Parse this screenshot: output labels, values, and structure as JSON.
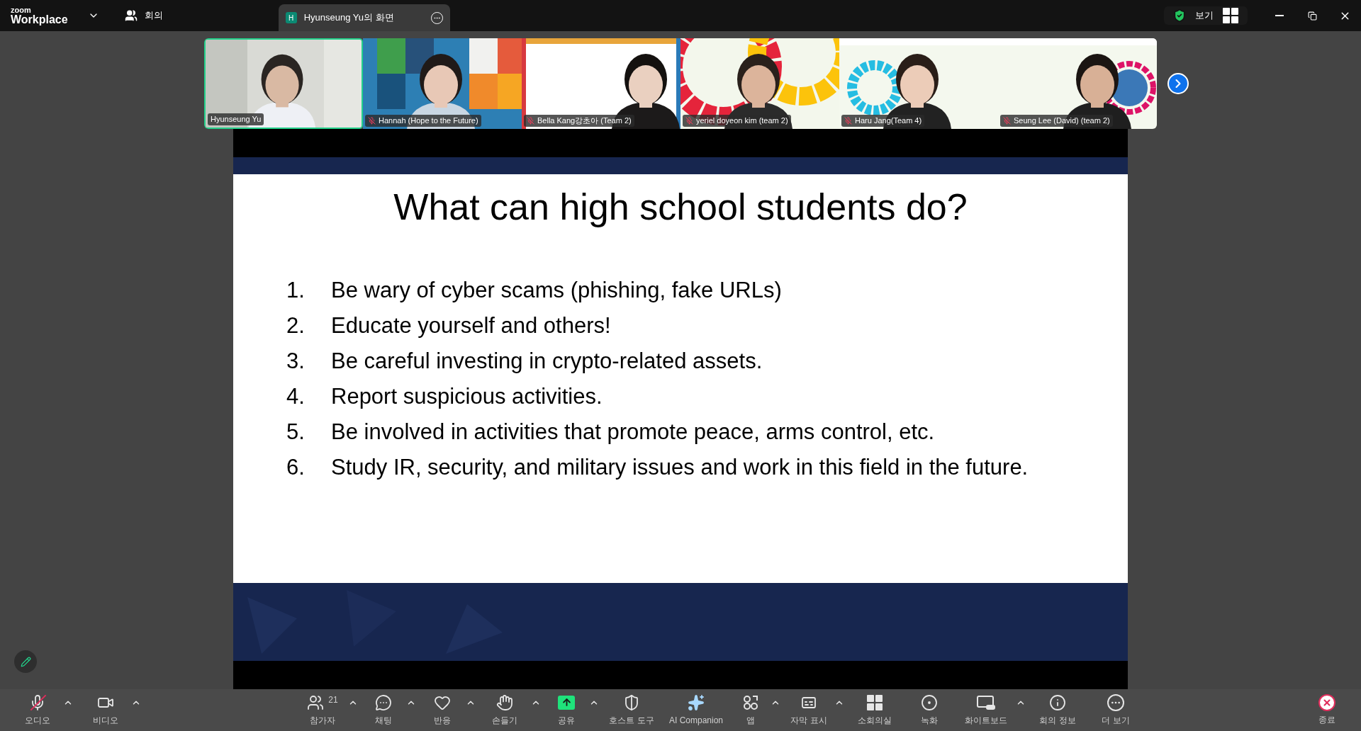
{
  "top_bar": {
    "logo_small": "zoom",
    "logo": "Workplace",
    "meeting": "회의",
    "tab": {
      "initial": "H",
      "title": "Hyunseung Yu의 화면"
    },
    "view": "보기"
  },
  "participants": [
    {
      "name": "Hyunseung Yu",
      "muted": false,
      "active": true
    },
    {
      "name": "Hannah (Hope to the Future)",
      "muted": true,
      "active": false
    },
    {
      "name": "Bella Kang강초아 (Team 2)",
      "muted": true,
      "active": false
    },
    {
      "name": "yeriel doyeon kim (team 2)",
      "muted": true,
      "active": false
    },
    {
      "name": "Haru Jang(Team 4)",
      "muted": true,
      "active": false
    },
    {
      "name": "Seung Lee (David) (team 2)",
      "muted": true,
      "active": false
    }
  ],
  "slide": {
    "title": "What can high school students do?",
    "items": [
      {
        "number": "1.",
        "text": "Be wary of cyber scams (phishing, fake URLs)"
      },
      {
        "number": "2.",
        "text": "Educate yourself and others!"
      },
      {
        "number": "3.",
        "text": "Be careful investing in crypto-related assets."
      },
      {
        "number": "4.",
        "text": "Report suspicious activities."
      },
      {
        "number": "5.",
        "text": "Be involved in activities that promote peace, arms control, etc."
      },
      {
        "number": "6.",
        "text": "Study IR, security, and military issues and work in this field in the future."
      }
    ]
  },
  "toolbar": {
    "left": [
      {
        "label": "오디오",
        "caret": true,
        "muted": true
      },
      {
        "label": "비디오",
        "caret": true
      }
    ],
    "center": [
      {
        "label": "참가자",
        "caret": true,
        "badge": "21"
      },
      {
        "label": "채팅",
        "caret": true
      },
      {
        "label": "반응",
        "caret": true
      },
      {
        "label": "손들기",
        "caret": true
      },
      {
        "label": "공유",
        "caret": true
      },
      {
        "label": "호스트 도구",
        "caret": false
      },
      {
        "label": "AI Companion",
        "caret": false
      },
      {
        "label": "앱",
        "caret": true
      },
      {
        "label": "자막 표시",
        "caret": true
      },
      {
        "label": "소회의실",
        "caret": false
      },
      {
        "label": "녹화",
        "caret": false
      },
      {
        "label": "화이트보드",
        "caret": true
      },
      {
        "label": "회의 정보",
        "caret": false
      },
      {
        "label": "더 보기",
        "caret": false
      }
    ],
    "end": {
      "label": "종료"
    }
  }
}
